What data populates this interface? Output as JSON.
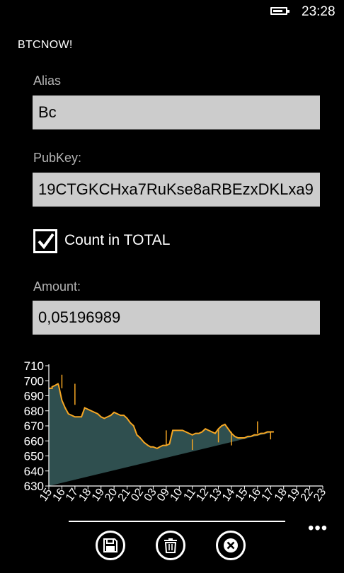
{
  "status": {
    "time": "23:28",
    "battery_fraction": 0.8
  },
  "app": {
    "title": "BTCNOW!"
  },
  "form": {
    "alias": {
      "label": "Alias",
      "value": "Bc"
    },
    "pubkey": {
      "label": "PubKey:",
      "value": "19CTGKCHxa7RuKse8aRBEzxDKLxa9"
    },
    "count_in_total": {
      "label": "Count in TOTAL",
      "checked": true
    },
    "amount": {
      "label": "Amount:",
      "value": "0,05196989"
    }
  },
  "chart_data": {
    "type": "area",
    "title": "",
    "xlabel": "",
    "ylabel": "",
    "ylim": [
      630,
      710
    ],
    "y_ticks": [
      630,
      640,
      650,
      660,
      670,
      680,
      690,
      700,
      710
    ],
    "x_tick_labels": [
      "15",
      "16",
      "17",
      "18",
      "19",
      "20",
      "21",
      "02",
      "03",
      "09",
      "10",
      "11",
      "12",
      "13",
      "14",
      "15",
      "16",
      "17",
      "18",
      "19",
      "22",
      "23"
    ],
    "x": [
      0,
      0.25,
      0.25,
      0.5,
      0.7,
      0.75,
      1,
      1.25,
      1.5,
      1.75,
      2,
      2.25,
      2.5,
      2.75,
      3,
      3.25,
      3.5,
      3.75,
      4,
      4.25,
      4.5,
      4.75,
      5,
      5.25,
      5.5,
      5.75,
      6,
      6.25,
      6.5,
      6.75,
      7,
      7.3,
      7.6,
      7.8,
      8,
      8.3,
      8.5,
      8.75,
      9,
      9.25,
      9.5,
      9.75,
      10,
      10.25,
      10.5,
      10.75,
      11,
      11.25,
      11.5,
      11.75,
      12,
      12.25,
      12.5,
      12.75,
      13,
      13.25,
      13.5,
      13.75,
      14,
      14.25,
      14.5,
      14.75,
      15,
      15.25,
      15.5,
      15.75,
      16,
      16.25,
      16.5,
      16.75,
      17,
      17.25,
      17.5,
      17.75,
      18,
      18.25,
      18.5,
      18.75,
      19,
      19.25,
      19.5,
      19.75,
      20,
      20.25,
      20.5,
      20.75,
      21
    ],
    "y": [
      695,
      695,
      696,
      697,
      698,
      697,
      687,
      682,
      678,
      677,
      676,
      676,
      676,
      682,
      681,
      680,
      679,
      678,
      676,
      675,
      676,
      677,
      679,
      678,
      677,
      677,
      675,
      672,
      670,
      664,
      662,
      659,
      657,
      656,
      656,
      655,
      656,
      657,
      657,
      658,
      667,
      667,
      667,
      667,
      666,
      665,
      664,
      665,
      665,
      666,
      668,
      667,
      666,
      665,
      668,
      670,
      671,
      668,
      665,
      663,
      662,
      662,
      662,
      663,
      663,
      664,
      664,
      665,
      665,
      666,
      666,
      666
    ],
    "spikes": [
      {
        "x": 1.0,
        "low": 695,
        "high": 704
      },
      {
        "x": 2.0,
        "low": 684,
        "high": 698
      },
      {
        "x": 9.0,
        "low": 657,
        "high": 667
      },
      {
        "x": 11.0,
        "low": 654,
        "high": 661
      },
      {
        "x": 13.0,
        "low": 659,
        "high": 668
      },
      {
        "x": 14.0,
        "low": 657,
        "high": 666
      },
      {
        "x": 16.0,
        "low": 665,
        "high": 673
      },
      {
        "x": 17.0,
        "low": 661,
        "high": 666
      }
    ],
    "fill_color": "#2f4f4f",
    "line_color": "#f5a623",
    "axis_color": "#ffffff"
  },
  "appbar": {
    "buttons": [
      {
        "name": "save",
        "icon": "floppy-disk-icon"
      },
      {
        "name": "delete",
        "icon": "trash-icon"
      },
      {
        "name": "cancel",
        "icon": "close-icon"
      }
    ],
    "more": "•••"
  }
}
